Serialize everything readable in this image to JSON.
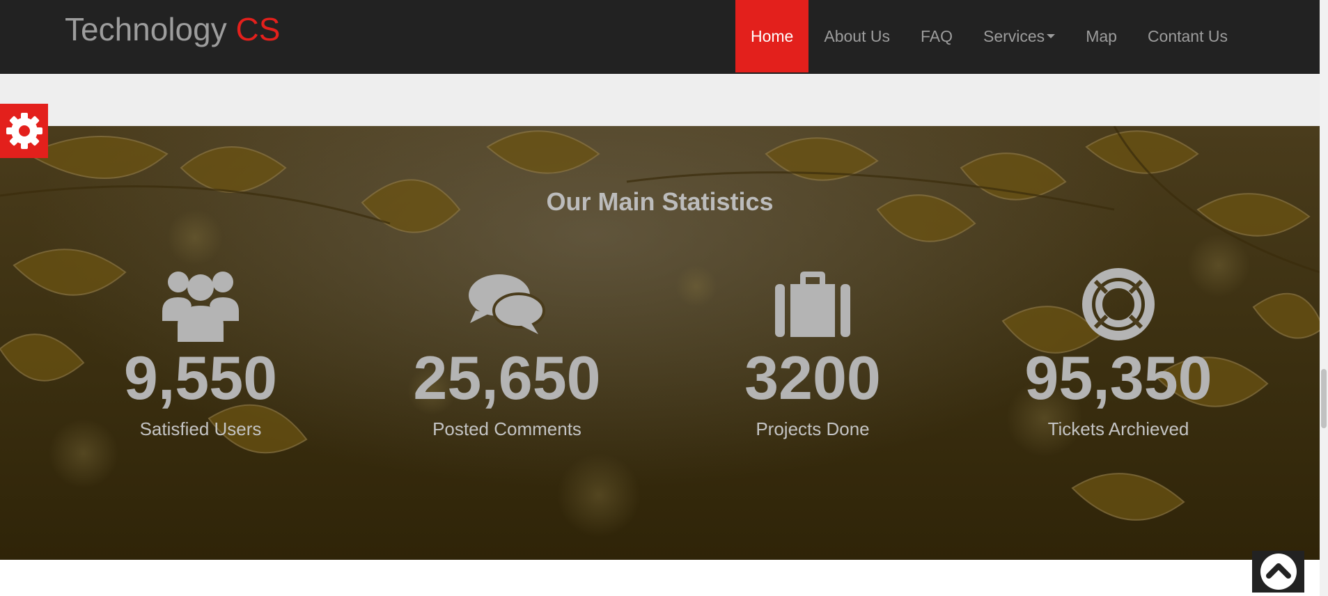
{
  "brand": {
    "name": "Technology",
    "accent": "CS"
  },
  "nav": {
    "items": [
      {
        "label": "Home",
        "active": true
      },
      {
        "label": "About Us"
      },
      {
        "label": "FAQ"
      },
      {
        "label": "Services",
        "dropdown": true
      },
      {
        "label": "Map"
      },
      {
        "label": "Contant Us"
      }
    ]
  },
  "stats": {
    "title": "Our Main Statistics",
    "items": [
      {
        "icon": "users-icon",
        "value": "9,550",
        "label": "Satisfied Users"
      },
      {
        "icon": "comments-icon",
        "value": "25,650",
        "label": "Posted Comments"
      },
      {
        "icon": "briefcase-icon",
        "value": "3200",
        "label": "Projects Done"
      },
      {
        "icon": "life-ring-icon",
        "value": "95,350",
        "label": "Tickets Archieved"
      }
    ]
  },
  "colors": {
    "accent": "#e3201c",
    "navbar": "#222222",
    "nav_text": "#9d9d9d",
    "strip": "#eeeeee",
    "stat_text": "#b4b4b4"
  }
}
